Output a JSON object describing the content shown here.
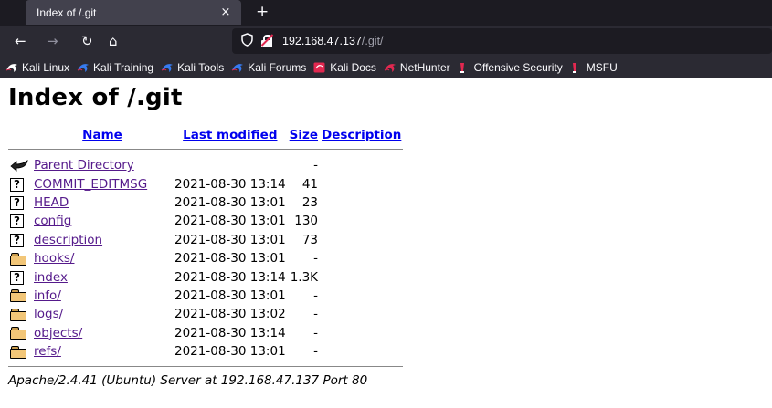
{
  "browser": {
    "tab": {
      "title": "Index of /.git",
      "close": "×"
    },
    "new_tab": "+",
    "nav": {
      "back": "←",
      "forward": "→",
      "reload": "↻",
      "home": "⌂"
    },
    "url": {
      "host": "192.168.47.137",
      "path": "/.git/"
    },
    "bookmarks": [
      {
        "label": "Kali Linux",
        "icon": "kali-dragon-icon",
        "color": "#ffffff"
      },
      {
        "label": "Kali Training",
        "icon": "kali-dragon-icon",
        "color": "#367bf0"
      },
      {
        "label": "Kali Tools",
        "icon": "kali-dragon-icon",
        "color": "#367bf0"
      },
      {
        "label": "Kali Forums",
        "icon": "kali-dragon-icon",
        "color": "#367bf0"
      },
      {
        "label": "Kali Docs",
        "icon": "kali-docs-icon",
        "color": "#e22850"
      },
      {
        "label": "NetHunter",
        "icon": "kali-dragon-icon",
        "color": "#e22850"
      },
      {
        "label": "Offensive Security",
        "icon": "offsec-icon",
        "color": "#e22850"
      },
      {
        "label": "MSFU",
        "icon": "offsec-icon",
        "color": "#e22850"
      }
    ]
  },
  "page": {
    "title": "Index of /.git",
    "columns": {
      "name": "Name",
      "last_modified": "Last modified",
      "size": "Size",
      "description": "Description"
    },
    "rows": [
      {
        "icon": "back",
        "name": "Parent Directory",
        "modified": "",
        "size": "-",
        "description": ""
      },
      {
        "icon": "unknown",
        "name": "COMMIT_EDITMSG",
        "modified": "2021-08-30 13:14",
        "size": "41",
        "description": ""
      },
      {
        "icon": "unknown",
        "name": "HEAD",
        "modified": "2021-08-30 13:01",
        "size": "23",
        "description": ""
      },
      {
        "icon": "unknown",
        "name": "config",
        "modified": "2021-08-30 13:01",
        "size": "130",
        "description": ""
      },
      {
        "icon": "unknown",
        "name": "description",
        "modified": "2021-08-30 13:01",
        "size": "73",
        "description": ""
      },
      {
        "icon": "folder",
        "name": "hooks/",
        "modified": "2021-08-30 13:01",
        "size": "-",
        "description": ""
      },
      {
        "icon": "unknown",
        "name": "index",
        "modified": "2021-08-30 13:14",
        "size": "1.3K",
        "description": ""
      },
      {
        "icon": "folder",
        "name": "info/",
        "modified": "2021-08-30 13:01",
        "size": "-",
        "description": ""
      },
      {
        "icon": "folder",
        "name": "logs/",
        "modified": "2021-08-30 13:02",
        "size": "-",
        "description": ""
      },
      {
        "icon": "folder",
        "name": "objects/",
        "modified": "2021-08-30 13:14",
        "size": "-",
        "description": ""
      },
      {
        "icon": "folder",
        "name": "refs/",
        "modified": "2021-08-30 13:01",
        "size": "-",
        "description": ""
      }
    ],
    "address": "Apache/2.4.41 (Ubuntu) Server at 192.168.47.137 Port 80"
  }
}
